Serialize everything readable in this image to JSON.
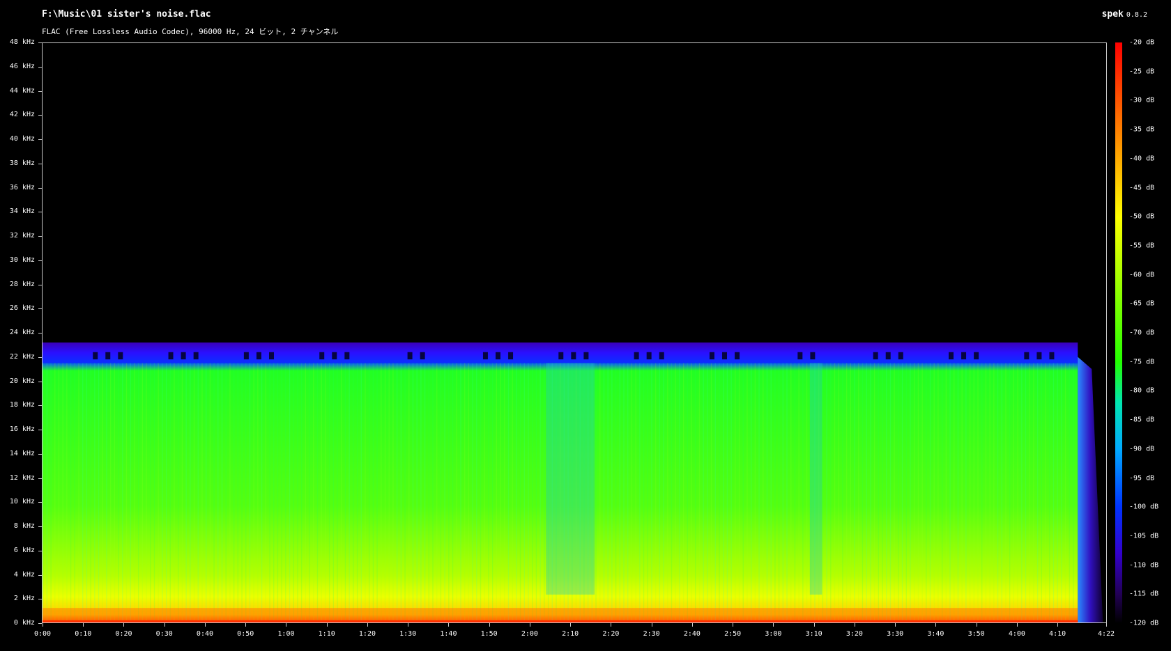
{
  "header": {
    "file_path": "F:\\Music\\01 sister's noise.flac",
    "audio_info": "FLAC (Free Lossless Audio Codec), 96000 Hz, 24 ビット, 2 チャンネル",
    "app_name": "spek",
    "app_version": "0.8.2"
  },
  "y_axis": {
    "ticks": [
      "48 kHz",
      "46 kHz",
      "44 kHz",
      "42 kHz",
      "40 kHz",
      "38 kHz",
      "36 kHz",
      "34 kHz",
      "32 kHz",
      "30 kHz",
      "28 kHz",
      "26 kHz",
      "24 kHz",
      "22 kHz",
      "20 kHz",
      "18 kHz",
      "16 kHz",
      "14 kHz",
      "12 kHz",
      "10 kHz",
      "8 kHz",
      "6 kHz",
      "4 kHz",
      "2 kHz",
      "0 kHz"
    ]
  },
  "x_axis": {
    "ticks": [
      "0:00",
      "0:10",
      "0:20",
      "0:30",
      "0:40",
      "0:50",
      "1:00",
      "1:10",
      "1:20",
      "1:30",
      "1:40",
      "1:50",
      "2:00",
      "2:10",
      "2:20",
      "2:30",
      "2:40",
      "2:50",
      "3:00",
      "3:10",
      "3:20",
      "3:30",
      "3:40",
      "3:50",
      "4:00",
      "4:10",
      "4:22"
    ]
  },
  "color_scale": {
    "labels": [
      "-20 dB",
      "-25 dB",
      "-30 dB",
      "-35 dB",
      "-40 dB",
      "-45 dB",
      "-50 dB",
      "-55 dB",
      "-60 dB",
      "-65 dB",
      "-70 dB",
      "-75 dB",
      "-80 dB",
      "-85 dB",
      "-90 dB",
      "-95 dB",
      "-100 dB",
      "-105 dB",
      "-110 dB",
      "-115 dB",
      "-120 dB"
    ]
  },
  "spectrogram": {
    "duration_s": 262,
    "max_freq_khz": 48,
    "cutoff_khz": 22,
    "content_end_s": 255,
    "quiet_sections_s": [
      [
        124,
        136
      ],
      [
        189,
        192
      ]
    ]
  }
}
